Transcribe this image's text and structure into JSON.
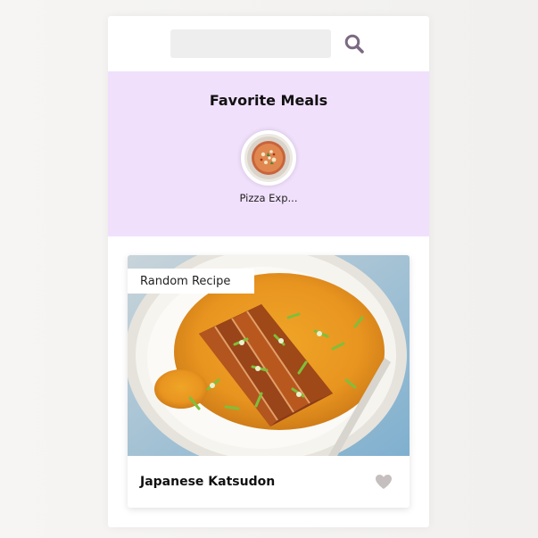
{
  "search": {
    "value": "",
    "placeholder": "",
    "icon": "search-icon"
  },
  "favorites": {
    "title": "Favorite Meals",
    "items": [
      {
        "name": "Pizza Exp..."
      }
    ]
  },
  "meal": {
    "tag": "Random Recipe",
    "name": "Japanese Katsudon",
    "favorite_icon": "heart-icon",
    "favorited": false
  },
  "colors": {
    "favorites_bg": "#f1e0fc",
    "search_icon": "#7b6a82",
    "heart_icon": "#c6bfbf",
    "page_bg": "#f4f3f1"
  }
}
